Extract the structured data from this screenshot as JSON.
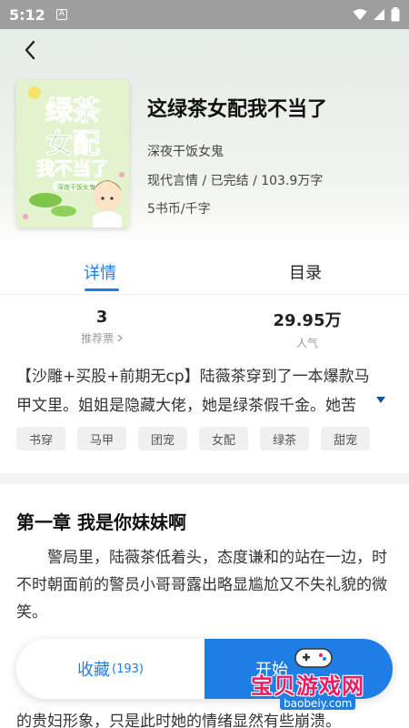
{
  "status_bar": {
    "time": "5:12",
    "notification_letter": "A"
  },
  "book": {
    "title": "这绿茶女配我不当了",
    "author": "深夜干饭女鬼",
    "meta": "现代言情 / 已完结 / 103.9万字",
    "price": "5书币/千字",
    "cover": {
      "line1": "绿茶",
      "line2": "女配",
      "line3": "我不当了",
      "author_tag": "深夜干饭女鬼"
    }
  },
  "tabs": [
    {
      "label": "详情",
      "active": true
    },
    {
      "label": "目录",
      "active": false
    }
  ],
  "stats": [
    {
      "value": "3",
      "label": "推荐票"
    },
    {
      "value": "29.95万",
      "label": "人气"
    }
  ],
  "intro": "【沙雕+买股+前期无cp】陆薇茶穿到了一本爆款马甲文里。姐姐是隐藏大佬，她是绿茶假千金。她苦",
  "tags": [
    "书穿",
    "马甲",
    "团宠",
    "女配",
    "绿茶",
    "甜宠"
  ],
  "chapter": {
    "title": "第一章 我是你妹妹啊",
    "text": "警局里，陆薇茶低着头，态度谦和的站在一边，时不时朝面前的警员小哥哥露出略显尴尬又不失礼貌的微笑。",
    "tail": "的贵妇形象，只是此时她的情绪显然有些崩溃。"
  },
  "bottom_bar": {
    "favorite_label": "收藏",
    "favorite_count": "(193)",
    "read_label": "开始"
  },
  "watermark": {
    "text": "宝贝游戏网",
    "url": "baobeiy.com"
  },
  "colors": {
    "accent": "#1f7ee6",
    "tag_bg": "#f0f0f0",
    "status_bar": "#9e9e9e"
  }
}
